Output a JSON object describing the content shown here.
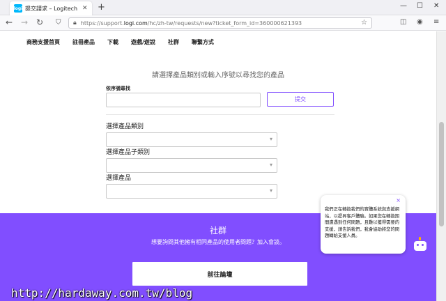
{
  "browser": {
    "tab_favicon": "logi",
    "tab_title": "提交請求 – Logitech 支援 + 下載",
    "tab_close_icon": "close-icon",
    "new_tab": "+",
    "url_prefix": "https://support.",
    "url_domain": "logi.com",
    "url_suffix": "/hc/zh-tw/requests/new?ticket_form_id=360000621393"
  },
  "site_nav": {
    "items": [
      "商務支援首頁",
      "註冊產品",
      "下載",
      "遊戲/遊說",
      "社群",
      "聯繫方式"
    ]
  },
  "form": {
    "title": "請選擇產品類別或輸入序號以尋找您的產品",
    "serial_label": "依序號尋找",
    "submit_label": "提交",
    "category_label": "選擇產品類別",
    "subcategory_label": "選擇產品子類別",
    "product_label": "選擇產品"
  },
  "community": {
    "title": "社群",
    "subtitle": "想要詢問其他擁有相同產品的使用者問題？加入會談。",
    "button_label": "前往論壇"
  },
  "chat": {
    "message": "我們正在轉換我們的實體系統與支援網站，以提昇客戶體驗。如果您在轉換期間遭遇到任何問題，且難以獲得需要的支援，請告訴我們，我會協助將您的問題轉給支援人員。",
    "close": "×"
  },
  "watermark": "http://hardaway.com.tw/blog",
  "colors": {
    "accent": "#814eff",
    "favicon": "#00b8fc",
    "bot_antenna": "#ffb000"
  }
}
